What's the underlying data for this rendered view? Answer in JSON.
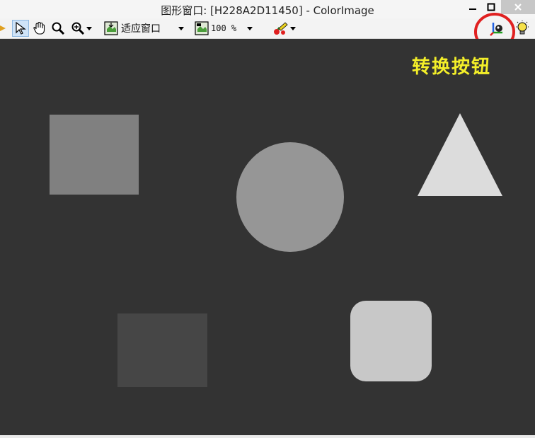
{
  "window": {
    "title": "图形窗口: [H228A2D11450] - ColorImage",
    "controls": {
      "minimize": "minimize-icon",
      "maximize": "maximize-icon",
      "close": "close-icon"
    }
  },
  "toolbar": {
    "fit_window_label": "适应窗口",
    "zoom_value": "100 %",
    "icons": [
      "pointer-icon",
      "hand-icon",
      "zoom-icon",
      "zoom-in-icon",
      "fit-icon",
      "palette-icon",
      "convert-icon",
      "bulb-icon"
    ]
  },
  "annotation": {
    "label": "转换按钮",
    "color": "#f3ee29",
    "circle_color": "#e02020"
  },
  "canvas": {
    "background": "#333333",
    "shapes": [
      {
        "name": "rect-top-left",
        "color": "#808080"
      },
      {
        "name": "circle-center",
        "color": "#969696"
      },
      {
        "name": "triangle-top-right",
        "color": "#dcdcdc"
      },
      {
        "name": "rect-bottom-left",
        "color": "#464646"
      },
      {
        "name": "rounded-square-bottom-right",
        "color": "#c8c8c8"
      }
    ]
  }
}
